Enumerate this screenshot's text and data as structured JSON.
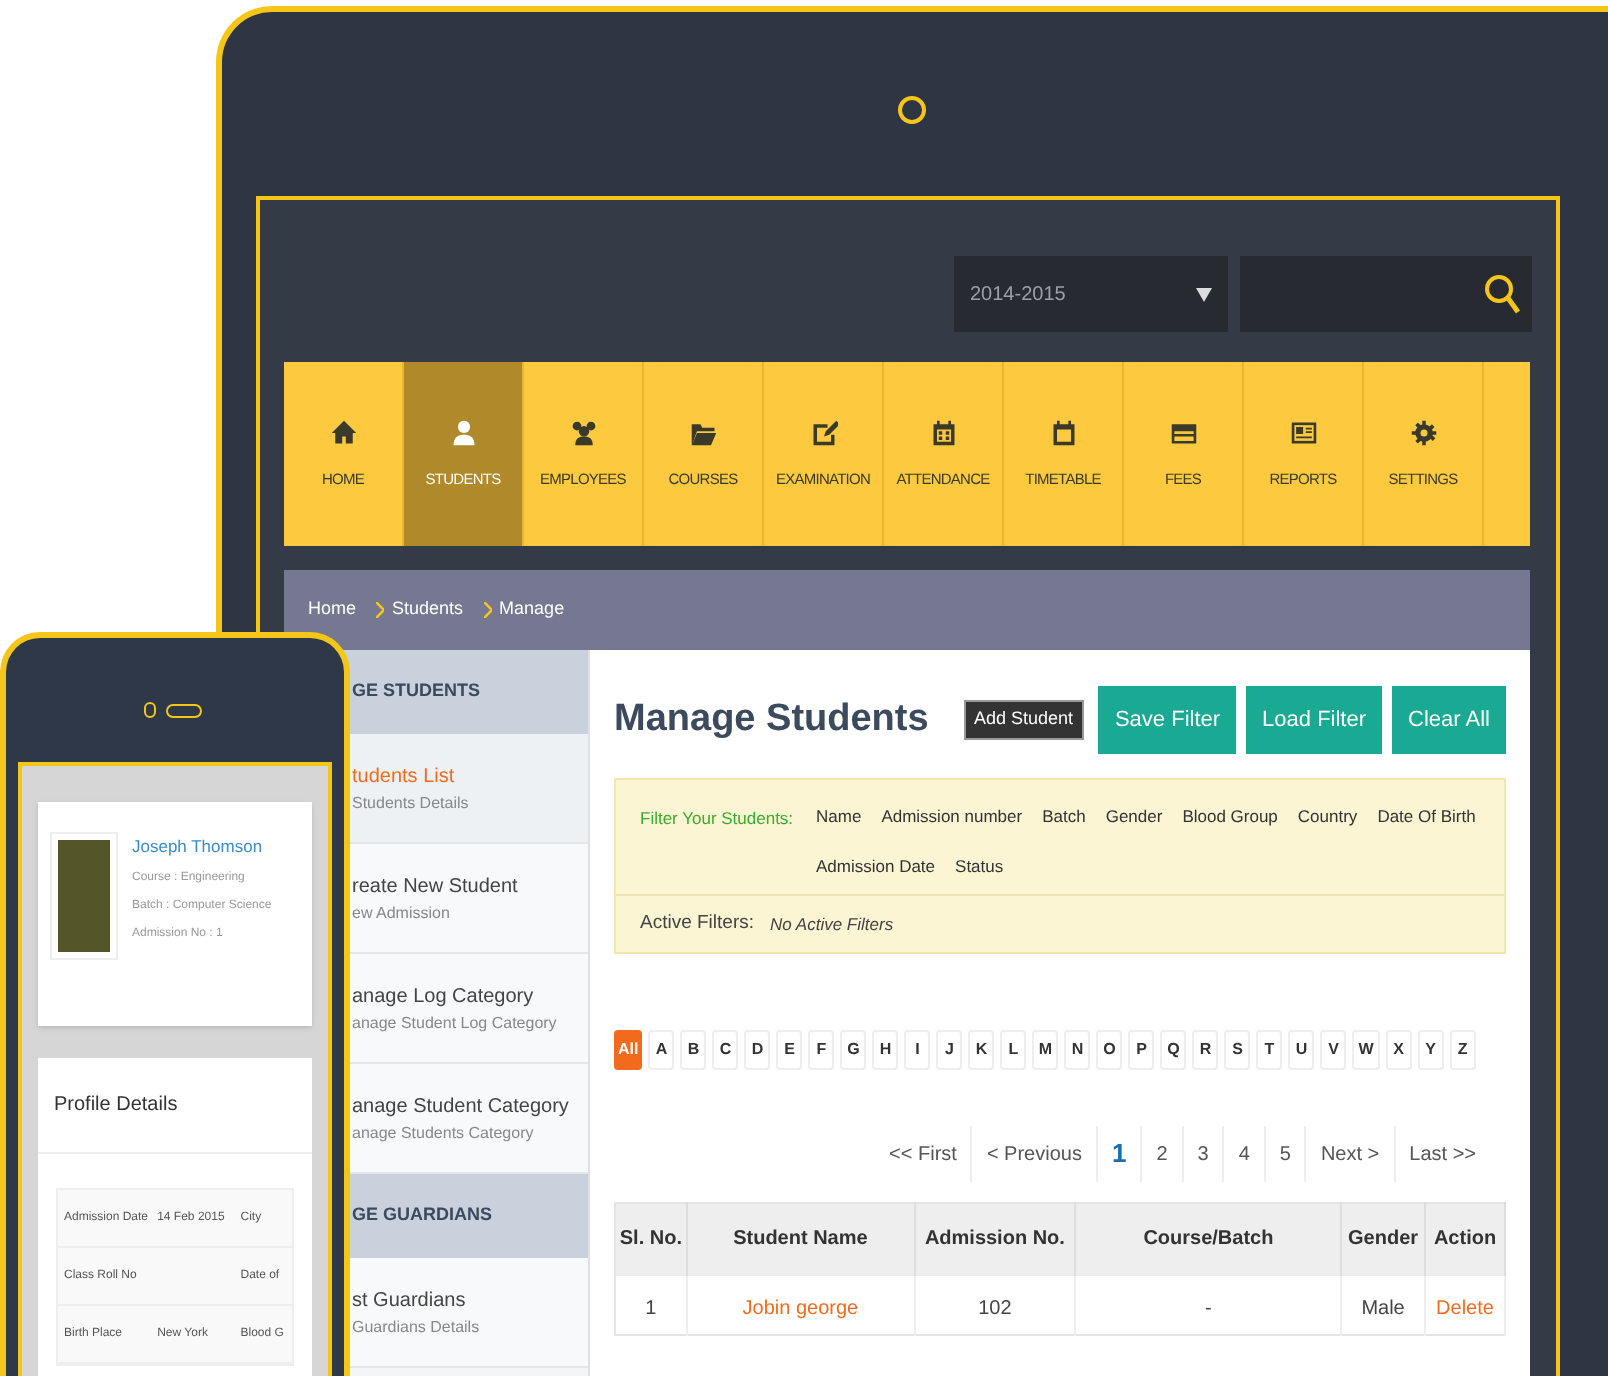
{
  "tablet": {
    "year_select": {
      "value": "2014-2015"
    },
    "nav": [
      {
        "label": "HOME",
        "selected": false
      },
      {
        "label": "STUDENTS",
        "selected": true
      },
      {
        "label": "EMPLOYEES",
        "selected": false
      },
      {
        "label": "COURSES",
        "selected": false
      },
      {
        "label": "EXAMINATION",
        "selected": false
      },
      {
        "label": "ATTENDANCE",
        "selected": false
      },
      {
        "label": "TIMETABLE",
        "selected": false
      },
      {
        "label": "FEES",
        "selected": false
      },
      {
        "label": "REPORTS",
        "selected": false
      },
      {
        "label": "SETTINGS",
        "selected": false
      }
    ],
    "breadcrumb": [
      "Home",
      "Students",
      "Manage"
    ],
    "sidebar": [
      {
        "kind": "heading",
        "title": "GE STUDENTS"
      },
      {
        "kind": "item",
        "title": "tudents List",
        "subtitle": "Students Details",
        "selected": true
      },
      {
        "kind": "item",
        "title": "reate New Student",
        "subtitle": "ew Admission",
        "selected": false
      },
      {
        "kind": "item",
        "title": "anage Log Category",
        "subtitle": "anage Student Log Category",
        "selected": false
      },
      {
        "kind": "item",
        "title": "anage Student Category",
        "subtitle": "anage Students Category",
        "selected": false
      },
      {
        "kind": "heading",
        "title": "GE GUARDIANS"
      },
      {
        "kind": "item",
        "title": "st Guardians",
        "subtitle": "Guardians Details",
        "selected": false
      }
    ],
    "page_title": "Manage Students",
    "add_button": "Add Student",
    "action_buttons": [
      "Save Filter",
      "Load Filter",
      "Clear All"
    ],
    "filter": {
      "label": "Filter Your Students:",
      "fields": [
        "Name",
        "Admission number",
        "Batch",
        "Gender",
        "Blood Group",
        "Country",
        "Date Of Birth",
        "Admission Date",
        "Status"
      ],
      "active_label": "Active Filters:",
      "active_value": "No Active Filters"
    },
    "letters": [
      {
        "label": "All",
        "selected": true
      },
      {
        "label": "A",
        "selected": false
      },
      {
        "label": "B",
        "selected": false
      },
      {
        "label": "C",
        "selected": false
      },
      {
        "label": "D",
        "selected": false
      },
      {
        "label": "E",
        "selected": false
      },
      {
        "label": "F",
        "selected": false
      },
      {
        "label": "G",
        "selected": false
      },
      {
        "label": "H",
        "selected": false
      },
      {
        "label": "I",
        "selected": false
      },
      {
        "label": "J",
        "selected": false
      },
      {
        "label": "K",
        "selected": false
      },
      {
        "label": "L",
        "selected": false
      },
      {
        "label": "M",
        "selected": false
      },
      {
        "label": "N",
        "selected": false
      },
      {
        "label": "O",
        "selected": false
      },
      {
        "label": "P",
        "selected": false
      },
      {
        "label": "Q",
        "selected": false
      },
      {
        "label": "R",
        "selected": false
      },
      {
        "label": "S",
        "selected": false
      },
      {
        "label": "T",
        "selected": false
      },
      {
        "label": "U",
        "selected": false
      },
      {
        "label": "V",
        "selected": false
      },
      {
        "label": "W",
        "selected": false
      },
      {
        "label": "X",
        "selected": false
      },
      {
        "label": "Y",
        "selected": false
      },
      {
        "label": "Z",
        "selected": false
      }
    ],
    "pagination": [
      {
        "label": "<< First",
        "selected": false
      },
      {
        "label": "< Previous",
        "selected": false
      },
      {
        "label": "1",
        "selected": true
      },
      {
        "label": "2",
        "selected": false
      },
      {
        "label": "3",
        "selected": false
      },
      {
        "label": "4",
        "selected": false
      },
      {
        "label": "5",
        "selected": false
      },
      {
        "label": "Next >",
        "selected": false
      },
      {
        "label": "Last >>",
        "selected": false
      }
    ],
    "table": {
      "columns": [
        "Sl. No.",
        "Student Name",
        "Admission No.",
        "Course/Batch",
        "Gender",
        "Action"
      ],
      "rows": [
        [
          "1",
          "Jobin george",
          "102",
          "-",
          "Male",
          "Delete"
        ]
      ]
    }
  },
  "phone": {
    "student": {
      "name": "Joseph Thomson",
      "lines": [
        "Course : Engineering",
        "Batch : Computer Science",
        "Admission No : 1"
      ]
    },
    "profile_title": "Profile Details",
    "profile_rows": [
      [
        "Admission Date",
        "14 Feb 2015",
        "City"
      ],
      [
        "Class Roll No",
        "",
        "Date of"
      ],
      [
        "Birth Place",
        "New York",
        "Blood G"
      ]
    ]
  }
}
